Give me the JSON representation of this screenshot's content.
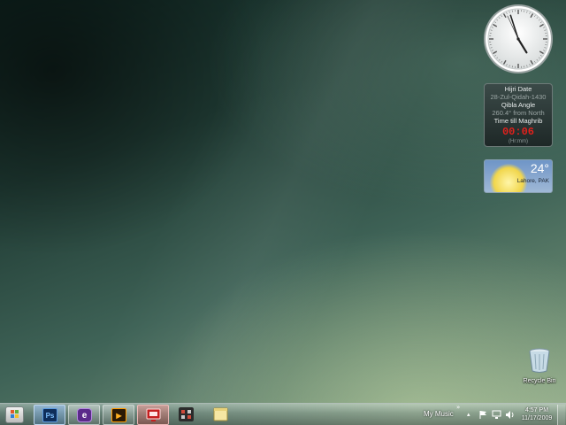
{
  "desktop": {
    "clock_gadget": {
      "hour": 4,
      "minute": 57
    },
    "info_gadget": {
      "hijri_label": "Hijri Date",
      "hijri_value": "28-Zul-Qidah-1430",
      "qibla_label": "Qibla Angle",
      "qibla_value": "260.4° from North",
      "maghrib_label": "Time till Maghrib",
      "countdown": "00:06",
      "unit": "(Hr:mm)"
    },
    "weather_gadget": {
      "temperature": "24°",
      "location": "Lahore, PAK"
    },
    "recycle_bin": {
      "label": "Recycle Bin"
    }
  },
  "taskbar": {
    "start_button": {
      "icon": "windows-logo-icon"
    },
    "apps": [
      {
        "name": "photoshop",
        "icon_text": "Ps",
        "state": "active"
      },
      {
        "name": "browser",
        "icon_text": "e",
        "state": "running"
      },
      {
        "name": "media-player",
        "icon_text": "▶",
        "state": "running"
      },
      {
        "name": "app-red",
        "icon_text": "",
        "state": "running"
      },
      {
        "name": "app-grid",
        "icon_text": "",
        "state": "pinned"
      },
      {
        "name": "sticky-notes",
        "icon_text": "",
        "state": "pinned"
      }
    ],
    "toolbar_label": "My Music",
    "toolbar_chevron": "»",
    "tray_expand": "▴",
    "tray_icons": [
      "flag-icon",
      "network-icon",
      "volume-icon"
    ],
    "time": "4:57 PM",
    "date": "11/17/2009"
  }
}
